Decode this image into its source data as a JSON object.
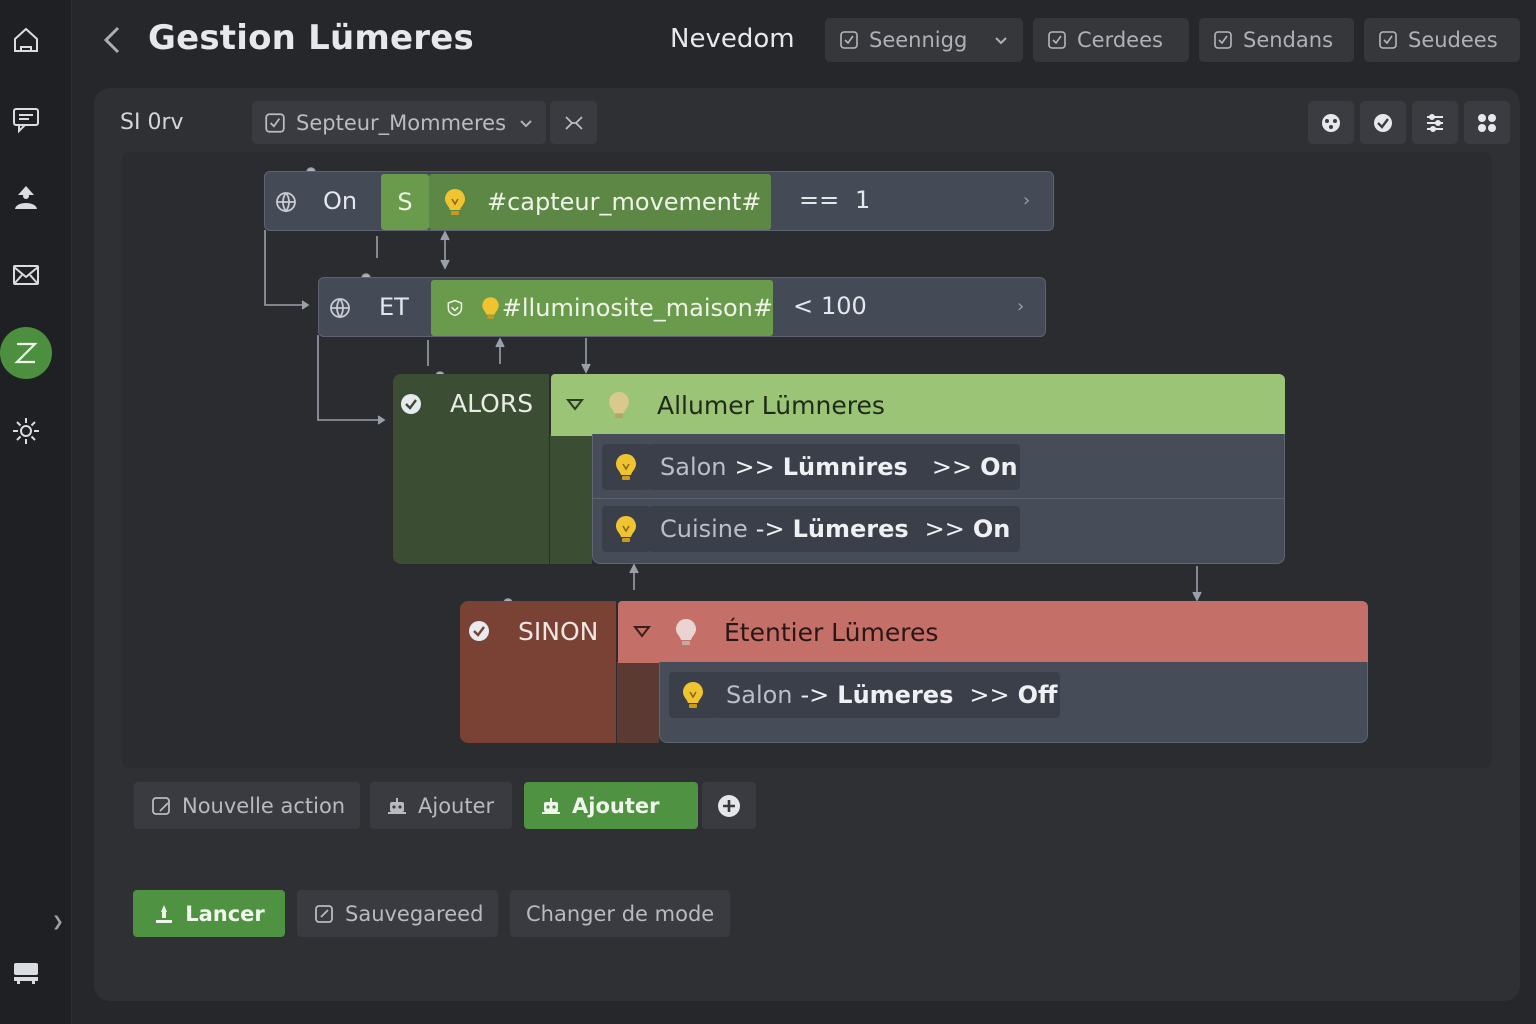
{
  "sidebar": {
    "items": [
      {
        "name": "home-icon"
      },
      {
        "name": "chat-icon"
      },
      {
        "name": "user-icon"
      },
      {
        "name": "mail-icon"
      },
      {
        "name": "scenario-icon",
        "active": true
      },
      {
        "name": "settings-icon"
      }
    ],
    "bottom_icon": "terminal-icon",
    "active_color": "#4c8f3f"
  },
  "header": {
    "title": "Gestion Lümeres",
    "app_name": "Nevedom",
    "buttons": [
      {
        "label": "Seennigg",
        "has_dropdown": true
      },
      {
        "label": "Cerdees"
      },
      {
        "label": "Sendans"
      },
      {
        "label": "Seudees"
      }
    ]
  },
  "toolbar": {
    "si_label": "SI 0rv",
    "selector_value": "Septeur_Mommeres"
  },
  "rule": {
    "condition1": {
      "keyword": "On",
      "prefix": "S",
      "variable": "#capteur_movement#",
      "operator": "==",
      "value": "1"
    },
    "condition2": {
      "keyword": "ET",
      "variable": "#lluminosite_maison#",
      "operator": "<",
      "value": "100"
    },
    "then_block": {
      "keyword": "ALORS",
      "title": "Allumer Lümneres",
      "actions": [
        {
          "room": "Salon",
          "arrow1": ">>",
          "target": "Lümnires",
          "arrow2": ">>",
          "state": "On"
        },
        {
          "room": "Cuisine",
          "arrow1": "->",
          "target": "Lümeres",
          "arrow2": ">>",
          "state": "On"
        }
      ]
    },
    "else_block": {
      "keyword": "SINON",
      "title": "Étentier Lümeres",
      "actions": [
        {
          "room": "Salon",
          "arrow1": "->",
          "target": "Lümeres",
          "arrow2": ">>",
          "state": "Off"
        }
      ]
    }
  },
  "actions_bar": {
    "new_action": "Nouvelle action",
    "add_grey": "Ajouter",
    "add_green": "Ajouter"
  },
  "footer": {
    "run": "Lancer",
    "save": "Sauvegareed",
    "change_mode": "Changer de mode"
  },
  "colors": {
    "then_header": "#9bc476",
    "else_header": "#c46f68",
    "green_button": "#4f9242",
    "bulb": "#f0c431"
  }
}
